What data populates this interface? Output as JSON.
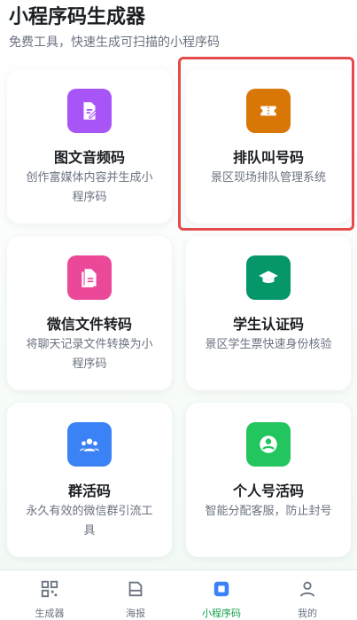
{
  "header": {
    "title": "小程序码生成器",
    "subtitle": "免费工具，快速生成可扫描的小程序码"
  },
  "cards": [
    {
      "title": "图文音频码",
      "desc": "创作富媒体内容并生成小程序码",
      "icon": "edit-document-icon",
      "color": "#a855f7"
    },
    {
      "title": "排队叫号码",
      "desc": "景区现场排队管理系统",
      "icon": "ticket-icon",
      "color": "#d97706"
    },
    {
      "title": "微信文件转码",
      "desc": "将聊天记录文件转换为小程序码",
      "icon": "file-icon",
      "color": "#ec4899"
    },
    {
      "title": "学生认证码",
      "desc": "景区学生票快速身份核验",
      "icon": "graduation-cap-icon",
      "color": "#059669"
    },
    {
      "title": "群活码",
      "desc": "永久有效的微信群引流工具",
      "icon": "group-icon",
      "color": "#3b82f6"
    },
    {
      "title": "个人号活码",
      "desc": "智能分配客服，防止封号",
      "icon": "user-icon",
      "color": "#22c55e"
    }
  ],
  "tabs": [
    {
      "label": "生成器",
      "icon": "qr-code-icon"
    },
    {
      "label": "海报",
      "icon": "poster-icon"
    },
    {
      "label": "小程序码",
      "icon": "mini-program-icon",
      "active": true
    },
    {
      "label": "我的",
      "icon": "profile-icon"
    }
  ],
  "colors": {
    "accent": "#16a34a",
    "highlight": "#e64b4b"
  }
}
